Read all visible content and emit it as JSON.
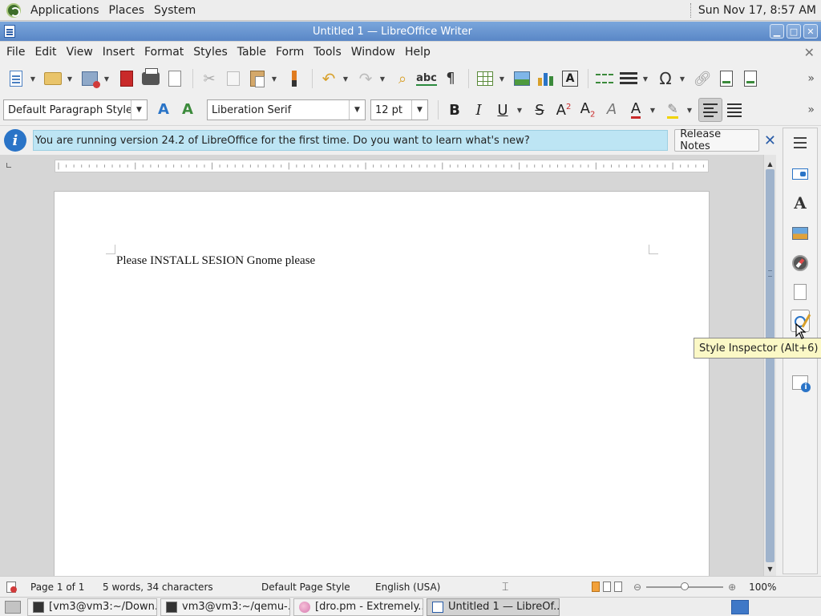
{
  "top_panel": {
    "menus": [
      "Applications",
      "Places",
      "System"
    ],
    "clock": "Sun Nov 17,  8:57 AM"
  },
  "window": {
    "title": "Untitled 1 — LibreOffice Writer"
  },
  "menubar": [
    "File",
    "Edit",
    "View",
    "Insert",
    "Format",
    "Styles",
    "Table",
    "Form",
    "Tools",
    "Window",
    "Help"
  ],
  "toolbar": {
    "icons": [
      "new-document-icon",
      "open-folder-icon",
      "save-icon",
      "export-pdf-icon",
      "print-icon",
      "print-preview-icon",
      "cut-icon",
      "copy-icon",
      "paste-icon",
      "clone-formatting-icon",
      "undo-icon",
      "redo-icon",
      "find-replace-icon",
      "spelling-icon",
      "formatting-marks-icon",
      "insert-table-icon",
      "insert-image-icon",
      "insert-chart-icon",
      "insert-textbox-icon",
      "page-break-icon",
      "insert-field-icon",
      "special-character-icon",
      "hyperlink-icon",
      "footnote-icon",
      "endnote-icon"
    ],
    "formatting_marks_glyph": "¶",
    "special_char_glyph": "Ω",
    "textbox_glyph": "A",
    "spelling_glyph": "abc"
  },
  "format_toolbar": {
    "paragraph_style": "Default Paragraph Style",
    "font_name": "Liberation Serif",
    "font_size": "12 pt",
    "bold": "B",
    "italic": "I",
    "underline": "U",
    "strike": "S",
    "superscript": "A",
    "superscript_mark": "2",
    "subscript": "A",
    "subscript_mark": "2",
    "clear_format": "A",
    "font_color": "A",
    "highlight": "✎",
    "alignment_active": "left"
  },
  "infobar": {
    "message": "You are running version 24.2 of LibreOffice for the first time. Do you want to learn what's new?",
    "button": "Release Notes",
    "close": "✕"
  },
  "document": {
    "text": "Please INSTALL SESION Gnome please"
  },
  "sidebar": {
    "items": [
      "sidebar-menu",
      "properties",
      "styles",
      "gallery",
      "navigator",
      "page",
      "style-inspector",
      "accessibility-check"
    ],
    "styles_glyph": "A"
  },
  "tooltip": "Style Inspector (Alt+6)",
  "statusbar": {
    "page": "Page 1 of 1",
    "words": "5 words, 34 characters",
    "page_style": "Default Page Style",
    "language": "English (USA)",
    "zoom_minus": "⊖",
    "zoom_plus": "⊕",
    "zoom": "100%",
    "zoom_fraction": 0.5
  },
  "taskbar": {
    "tasks": [
      "[vm3@vm3:~/Down...",
      "vm3@vm3:~/qemu-...",
      "[dro.pm - Extremely...",
      "Untitled 1 — LibreOf..."
    ]
  },
  "colors": {
    "titlebar": "#5a87c6",
    "infobar_message": "#bde5f4",
    "tooltip": "#fbf8c6",
    "scroll_thumb": "#9fb3cc"
  }
}
